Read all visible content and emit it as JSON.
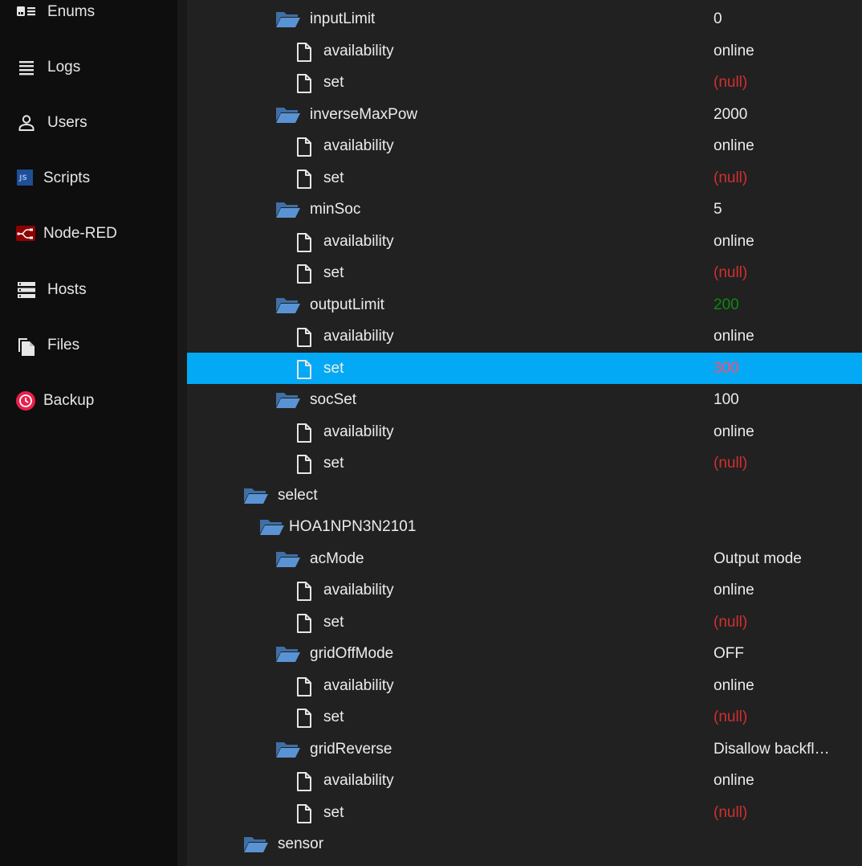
{
  "sidebar": {
    "items": [
      {
        "label": "Enums",
        "icon": "enums-icon"
      },
      {
        "label": "Logs",
        "icon": "logs-icon"
      },
      {
        "label": "Users",
        "icon": "user-icon"
      },
      {
        "label": "Scripts",
        "icon": "js-icon"
      },
      {
        "label": "Node-RED",
        "icon": "node-red-icon"
      },
      {
        "label": "Hosts",
        "icon": "hosts-icon"
      },
      {
        "label": "Files",
        "icon": "files-icon"
      },
      {
        "label": "Backup",
        "icon": "backup-icon"
      }
    ]
  },
  "colors": {
    "selected": "#03a9f4",
    "null_value": "#d32f2f",
    "acknowledged_value": "#0d8a0d",
    "folder": "#4f8fd0"
  },
  "tree": {
    "rows": [
      {
        "type": "folder",
        "level": 3,
        "name": "inputLimit",
        "value": "0",
        "style": "normal"
      },
      {
        "type": "state",
        "level": 4,
        "name": "availability",
        "value": "online",
        "style": "normal"
      },
      {
        "type": "state",
        "level": 4,
        "name": "set",
        "value": "(null)",
        "style": "null"
      },
      {
        "type": "folder",
        "level": 3,
        "name": "inverseMaxPow",
        "value": "2000",
        "style": "normal"
      },
      {
        "type": "state",
        "level": 4,
        "name": "availability",
        "value": "online",
        "style": "normal"
      },
      {
        "type": "state",
        "level": 4,
        "name": "set",
        "value": "(null)",
        "style": "null"
      },
      {
        "type": "folder",
        "level": 3,
        "name": "minSoc",
        "value": "5",
        "style": "normal"
      },
      {
        "type": "state",
        "level": 4,
        "name": "availability",
        "value": "online",
        "style": "normal"
      },
      {
        "type": "state",
        "level": 4,
        "name": "set",
        "value": "(null)",
        "style": "null"
      },
      {
        "type": "folder",
        "level": 3,
        "name": "outputLimit",
        "value": "200",
        "style": "green"
      },
      {
        "type": "state",
        "level": 4,
        "name": "availability",
        "value": "online",
        "style": "normal"
      },
      {
        "type": "state",
        "level": 4,
        "name": "set",
        "value": "300",
        "style": "pink",
        "selected": true
      },
      {
        "type": "folder",
        "level": 3,
        "name": "socSet",
        "value": "100",
        "style": "normal"
      },
      {
        "type": "state",
        "level": 4,
        "name": "availability",
        "value": "online",
        "style": "normal"
      },
      {
        "type": "state",
        "level": 4,
        "name": "set",
        "value": "(null)",
        "style": "null"
      },
      {
        "type": "folder",
        "level": 1,
        "name": "select",
        "value": "",
        "style": "normal"
      },
      {
        "type": "folder",
        "level": 2,
        "name": "HOA1NPN3N2101",
        "value": "",
        "style": "normal"
      },
      {
        "type": "folder",
        "level": 3,
        "name": "acMode",
        "value": "Output mode",
        "style": "normal"
      },
      {
        "type": "state",
        "level": 4,
        "name": "availability",
        "value": "online",
        "style": "normal"
      },
      {
        "type": "state",
        "level": 4,
        "name": "set",
        "value": "(null)",
        "style": "null"
      },
      {
        "type": "folder",
        "level": 3,
        "name": "gridOffMode",
        "value": "OFF",
        "style": "normal"
      },
      {
        "type": "state",
        "level": 4,
        "name": "availability",
        "value": "online",
        "style": "normal"
      },
      {
        "type": "state",
        "level": 4,
        "name": "set",
        "value": "(null)",
        "style": "null"
      },
      {
        "type": "folder",
        "level": 3,
        "name": "gridReverse",
        "value": "Disallow backfl…",
        "style": "normal"
      },
      {
        "type": "state",
        "level": 4,
        "name": "availability",
        "value": "online",
        "style": "normal"
      },
      {
        "type": "state",
        "level": 4,
        "name": "set",
        "value": "(null)",
        "style": "null"
      },
      {
        "type": "folder",
        "level": 1,
        "name": "sensor",
        "value": "",
        "style": "normal"
      }
    ]
  }
}
